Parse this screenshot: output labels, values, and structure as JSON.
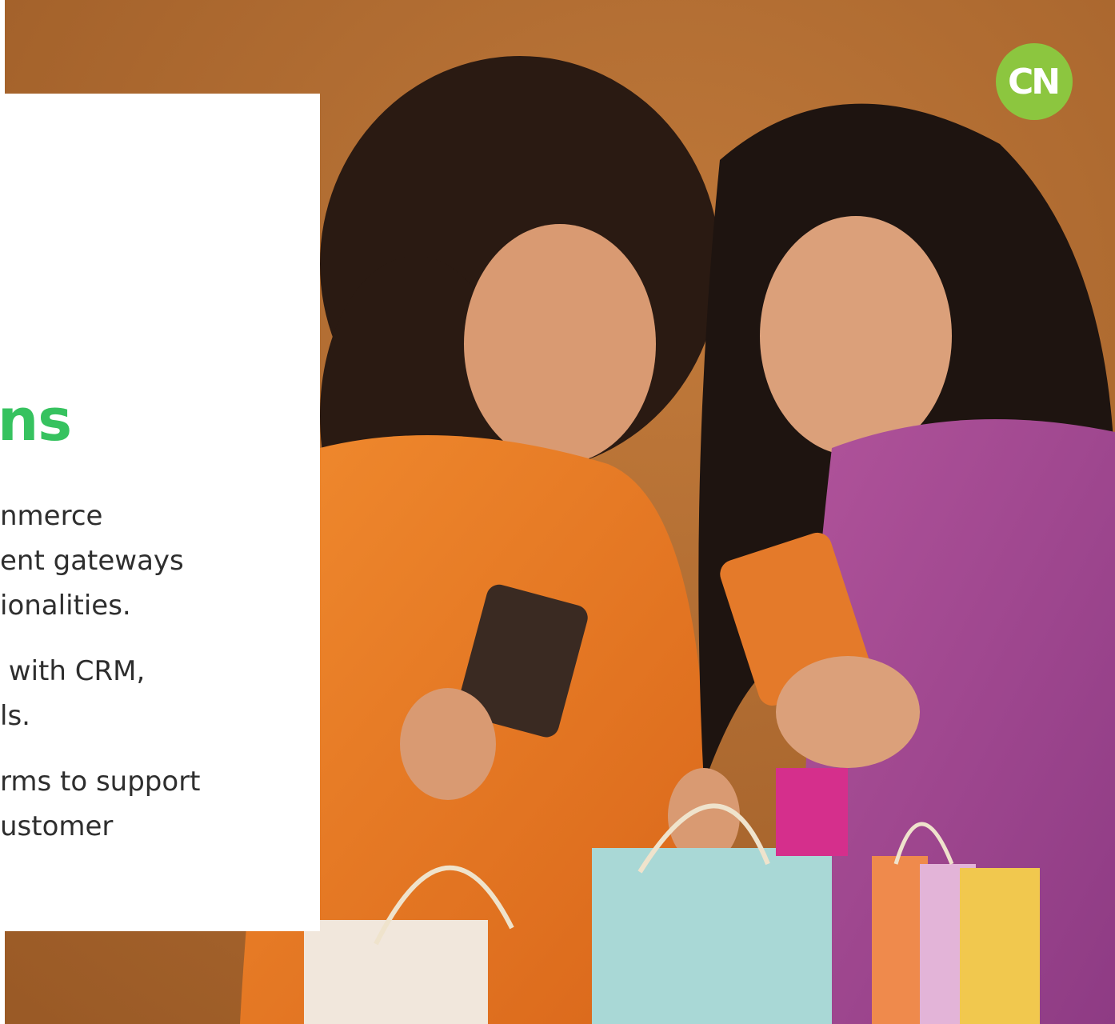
{
  "logo": {
    "text": "CN",
    "color": "#8cc63f"
  },
  "card": {
    "heading": "ns",
    "heading_color": "#36c25f",
    "paragraphs": [
      {
        "lines": [
          "nmerce",
          "ent gateways",
          "ionalities."
        ]
      },
      {
        "lines": [
          " with CRM,",
          "ls."
        ]
      },
      {
        "lines": [
          "rms to support",
          "ustomer"
        ]
      }
    ]
  },
  "photo": {
    "subject": "two-women-shopping-image",
    "background_color": "#b06a2e"
  }
}
